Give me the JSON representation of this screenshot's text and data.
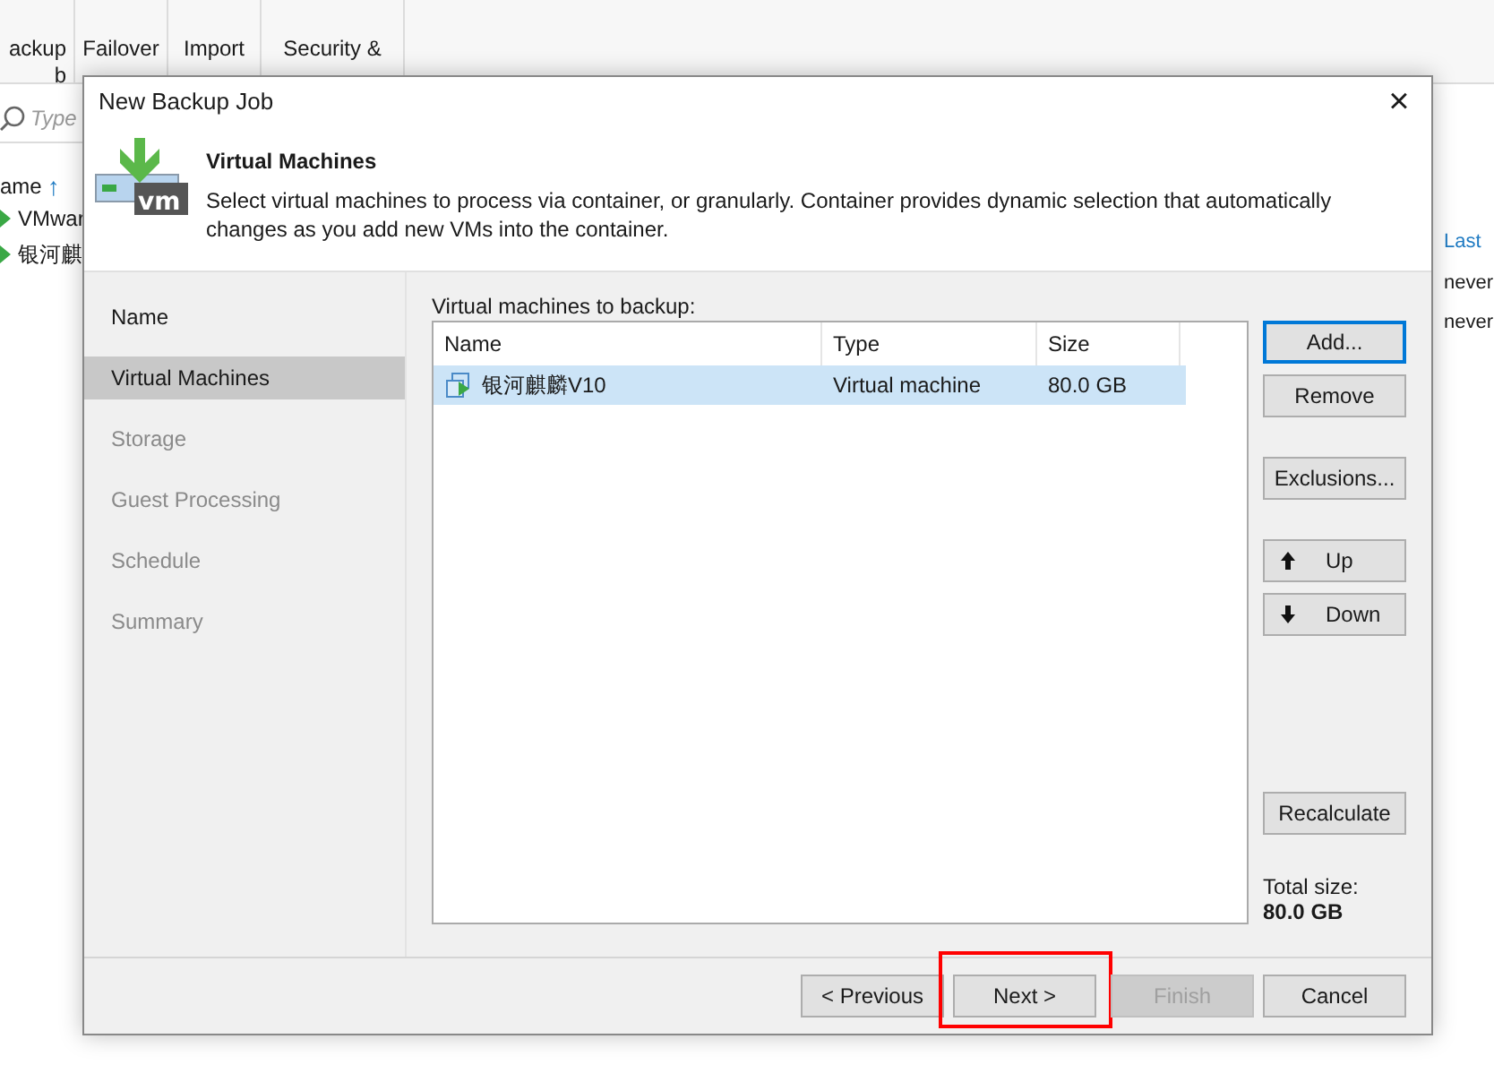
{
  "background_app": {
    "toolbar": [
      {
        "lines": [
          "ackup",
          "b"
        ]
      },
      {
        "lines": [
          "Failover"
        ]
      },
      {
        "lines": [
          "Import"
        ]
      },
      {
        "lines": [
          "Security &"
        ]
      }
    ],
    "search": {
      "placeholder": "Type"
    },
    "list": {
      "header": "ame",
      "sort_arrow": "↑",
      "items": [
        "VMwar",
        "银河麒"
      ]
    },
    "right_column": {
      "header": "Last",
      "values": [
        "never",
        "never"
      ]
    }
  },
  "dialog": {
    "title": "New Backup Job",
    "close": "×",
    "header": {
      "icon_text": "vm",
      "title": "Virtual Machines",
      "description": "Select virtual machines to process via container, or granularly. Container provides dynamic selection that automatically changes as you add new VMs into the container."
    },
    "steps": [
      {
        "label": "Name",
        "selected": false,
        "disabled": false
      },
      {
        "label": "Virtual Machines",
        "selected": true,
        "disabled": false
      },
      {
        "label": "Storage",
        "selected": false,
        "disabled": true
      },
      {
        "label": "Guest Processing",
        "selected": false,
        "disabled": true
      },
      {
        "label": "Schedule",
        "selected": false,
        "disabled": true
      },
      {
        "label": "Summary",
        "selected": false,
        "disabled": true
      }
    ],
    "list_label": "Virtual machines to backup:",
    "table": {
      "columns": [
        "Name",
        "Type",
        "Size"
      ],
      "rows": [
        {
          "cells": [
            "银河麒麟V10",
            "Virtual machine",
            "80.0 GB"
          ],
          "selected": true
        }
      ]
    },
    "side_button_groups": [
      [
        {
          "label": "Add...",
          "kind": "plain",
          "focused": true
        },
        {
          "label": "Remove",
          "kind": "plain",
          "focused": false
        }
      ],
      [
        {
          "label": "Exclusions...",
          "kind": "plain",
          "focused": false
        }
      ],
      [
        {
          "label": "Up",
          "kind": "up",
          "focused": false
        },
        {
          "label": "Down",
          "kind": "down",
          "focused": false
        }
      ],
      [
        {
          "label": "Recalculate",
          "kind": "plain",
          "focused": false
        }
      ]
    ],
    "total": {
      "label": "Total size:",
      "value": "80.0 GB"
    },
    "footer_buttons": [
      {
        "label": "< Previous",
        "disabled": false,
        "highlighted": false
      },
      {
        "label": "Next >",
        "disabled": false,
        "highlighted": true
      },
      {
        "label": "Finish",
        "disabled": true,
        "highlighted": false
      },
      {
        "label": "Cancel",
        "disabled": false,
        "highlighted": false
      }
    ]
  }
}
